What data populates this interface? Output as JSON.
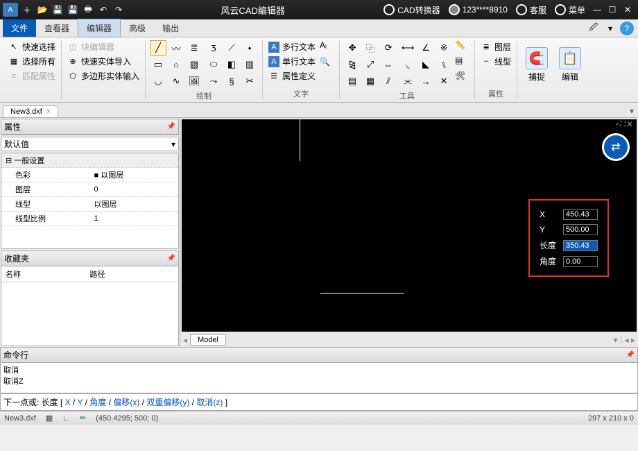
{
  "title_app": "风云CAD编辑器",
  "title_convert": "CAD转换器",
  "title_user": "123****8910",
  "title_support": "客服",
  "title_menu": "菜单",
  "menu": {
    "file": "文件",
    "viewer": "查看器",
    "editor": "编辑器",
    "advanced": "高级",
    "output": "输出"
  },
  "ribbon": {
    "sel_quick": "快速选择",
    "sel_all": "选择所有",
    "sel_match": "匹配属性",
    "blk_editor": "块编辑器",
    "blk_import": "快速实体导入",
    "blk_poly": "多边形实体输入",
    "grp_draw": "绘制",
    "txt_multi": "多行文本",
    "txt_single": "单行文本",
    "txt_attr": "属性定义",
    "grp_text": "文字",
    "grp_tool": "工具",
    "layer": "图层",
    "ltype": "线型",
    "grp_prop": "属性",
    "snap": "捕捉",
    "edit": "编辑"
  },
  "file_tab": "New3.dxf",
  "panel": {
    "props": "属性",
    "default": "默认值",
    "general": "一般设置",
    "color": "色彩",
    "color_v": "以图层",
    "layer": "图层",
    "layer_v": "0",
    "ltype": "线型",
    "ltype_v": "以图层",
    "lscale": "线型比例",
    "lscale_v": "1",
    "fav": "收藏夹",
    "fav_name": "名称",
    "fav_path": "路径"
  },
  "coord": {
    "x": "X",
    "x_v": "450.43",
    "y": "Y",
    "y_v": "500.00",
    "len": "长度",
    "len_v": "350.43",
    "ang": "角度",
    "ang_v": "0.00"
  },
  "viewtab": "Model",
  "cmd": {
    "title": "命令行",
    "l1": "取消",
    "l2": "取消Z",
    "prompt_pre": "下一点或: 长度 [ ",
    "x": "X",
    "y": "Y",
    "ang": "角度",
    "off": "偏移(x)",
    "doff": "双重偏移(y)",
    "cancel": "取消(z)",
    "prompt_post": " ]"
  },
  "status": {
    "file": "New3.dxf",
    "coord": "(450.4295; 500; 0)",
    "dim": "297 x 210 x 0"
  }
}
